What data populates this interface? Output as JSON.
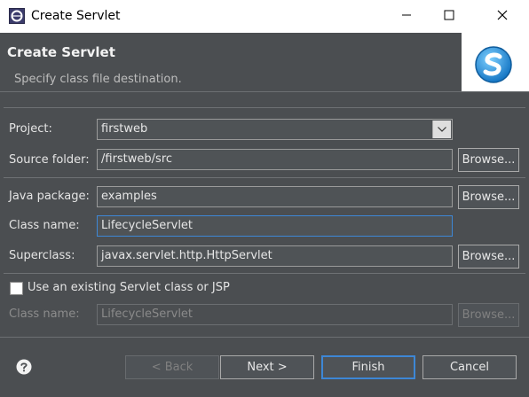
{
  "window": {
    "title": "Create Servlet"
  },
  "header": {
    "title": "Create Servlet",
    "subtitle": "Specify class file destination."
  },
  "form": {
    "project_label": "Project:",
    "project_value": "firstweb",
    "source_folder_label": "Source folder:",
    "source_folder_value": "/firstweb/src",
    "java_package_label": "Java package:",
    "java_package_value": "examples",
    "class_name_label": "Class name:",
    "class_name_value": "LifecycleServlet",
    "superclass_label": "Superclass:",
    "superclass_value": "javax.servlet.http.HttpServlet",
    "browse_label": "Browse...",
    "use_existing_label": "Use an existing Servlet class or JSP",
    "use_existing_checked": false,
    "existing_class_name_label": "Class name:",
    "existing_class_name_value": "LifecycleServlet"
  },
  "buttons": {
    "back": "< Back",
    "next": "Next >",
    "finish": "Finish",
    "cancel": "Cancel"
  },
  "colors": {
    "background": "#4b4e51",
    "focus_accent": "#3d87d6",
    "banner_blue": "#1e8ed8"
  },
  "icons": [
    "eclipse-app-icon",
    "minimize-icon",
    "maximize-icon",
    "close-icon",
    "servlet-wizard-icon",
    "help-icon",
    "chevron-down-icon"
  ]
}
